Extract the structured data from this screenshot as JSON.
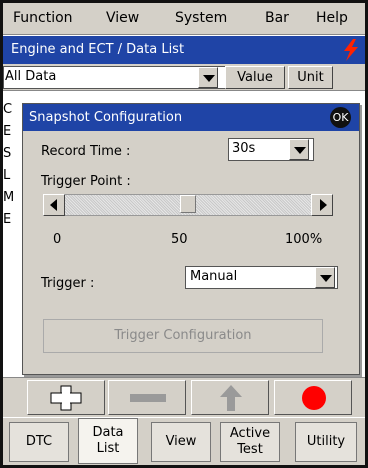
{
  "menu": [
    "Function",
    "View",
    "System",
    "Bar",
    "Help"
  ],
  "window": {
    "title": "Engine and ECT / Data List",
    "status_icon": "lightning-icon",
    "accent": "#1f44a6",
    "status_color": "#ff2200"
  },
  "filter": {
    "selected": "All Data",
    "value_label": "Value",
    "unit_label": "Unit"
  },
  "list_chars": [
    "C",
    "E",
    "S",
    "L",
    "M",
    "E"
  ],
  "dialog": {
    "title": "Snapshot Configuration",
    "ok_label": "OK",
    "record_time_label": "Record Time :",
    "record_time_value": "30s",
    "trigger_point_label": "Trigger Point :",
    "trigger_point_percent": 50,
    "ticks": [
      "0",
      "50",
      "100%"
    ],
    "trigger_label": "Trigger :",
    "trigger_value": "Manual",
    "trigger_config_label": "Trigger Configuration"
  },
  "toolbar": {
    "buttons": [
      "plus-icon",
      "minus-icon",
      "up-arrow-icon",
      "record-icon"
    ],
    "record_color": "#ff0000"
  },
  "tabs": [
    {
      "line1": "DTC",
      "line2": ""
    },
    {
      "line1": "Data",
      "line2": "List"
    },
    {
      "line1": "View",
      "line2": ""
    },
    {
      "line1": "Active",
      "line2": "Test"
    },
    {
      "line1": "Utility",
      "line2": ""
    }
  ]
}
